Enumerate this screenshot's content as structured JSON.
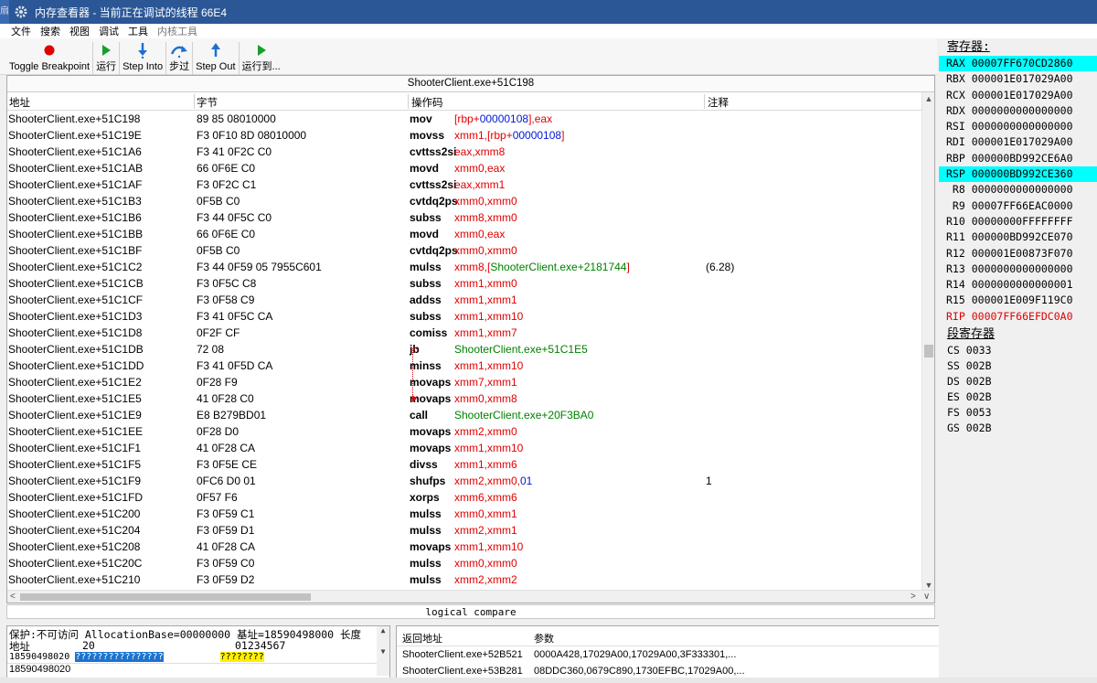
{
  "window": {
    "title": "内存查看器 - 当前正在调试的线程 66E4",
    "left_edge_text": "扇"
  },
  "menu": [
    "文件",
    "搜索",
    "视图",
    "调试",
    "工具",
    "内核工具"
  ],
  "toolbar": {
    "toggle_breakpoint": "Toggle Breakpoint",
    "run": "运行",
    "step_into": "Step Into",
    "step_over": "步过",
    "step_out": "Step Out",
    "run_to": "运行到..."
  },
  "disassembler": {
    "address_header": "ShooterClient.exe+51C198",
    "columns": {
      "address": "地址",
      "bytes": "字节",
      "opcode": "操作码",
      "comment": "注释"
    },
    "rows": [
      {
        "address": "ShooterClient.exe+51C198",
        "bytes": "89 85 08010000",
        "mnemonic": "mov",
        "operands": [
          {
            "t": "[rbp+",
            "c": "r"
          },
          {
            "t": "00000108",
            "c": "b"
          },
          {
            "t": "],eax",
            "c": "r"
          }
        ],
        "comment": ""
      },
      {
        "address": "ShooterClient.exe+51C19E",
        "bytes": "F3 0F10 8D 08010000",
        "mnemonic": "movss",
        "operands": [
          {
            "t": "xmm1,[rbp+",
            "c": "r"
          },
          {
            "t": "00000108",
            "c": "b"
          },
          {
            "t": "]",
            "c": "r"
          }
        ],
        "comment": ""
      },
      {
        "address": "ShooterClient.exe+51C1A6",
        "bytes": "F3 41 0F2C C0",
        "mnemonic": "cvttss2si",
        "operands": [
          {
            "t": "eax,xmm8",
            "c": "r"
          }
        ],
        "comment": ""
      },
      {
        "address": "ShooterClient.exe+51C1AB",
        "bytes": "66 0F6E C0",
        "mnemonic": "movd",
        "operands": [
          {
            "t": "xmm0,eax",
            "c": "r"
          }
        ],
        "comment": ""
      },
      {
        "address": "ShooterClient.exe+51C1AF",
        "bytes": "F3 0F2C C1",
        "mnemonic": "cvttss2si",
        "operands": [
          {
            "t": "eax,xmm1",
            "c": "r"
          }
        ],
        "comment": ""
      },
      {
        "address": "ShooterClient.exe+51C1B3",
        "bytes": "0F5B C0",
        "mnemonic": "cvtdq2ps",
        "operands": [
          {
            "t": "xmm0,xmm0",
            "c": "r"
          }
        ],
        "comment": ""
      },
      {
        "address": "ShooterClient.exe+51C1B6",
        "bytes": "F3 44 0F5C C0",
        "mnemonic": "subss",
        "operands": [
          {
            "t": "xmm8,xmm0",
            "c": "r"
          }
        ],
        "comment": ""
      },
      {
        "address": "ShooterClient.exe+51C1BB",
        "bytes": "66 0F6E C0",
        "mnemonic": "movd",
        "operands": [
          {
            "t": "xmm0,eax",
            "c": "r"
          }
        ],
        "comment": ""
      },
      {
        "address": "ShooterClient.exe+51C1BF",
        "bytes": "0F5B C0",
        "mnemonic": "cvtdq2ps",
        "operands": [
          {
            "t": "xmm0,xmm0",
            "c": "r"
          }
        ],
        "comment": ""
      },
      {
        "address": "ShooterClient.exe+51C1C2",
        "bytes": "F3 44 0F59 05 7955C601",
        "mnemonic": "mulss",
        "operands": [
          {
            "t": "xmm8,[",
            "c": "r"
          },
          {
            "t": "ShooterClient.exe+2181744",
            "c": "g"
          },
          {
            "t": "]",
            "c": "r"
          }
        ],
        "comment": "(6.28)"
      },
      {
        "address": "ShooterClient.exe+51C1CB",
        "bytes": "F3 0F5C C8",
        "mnemonic": "subss",
        "operands": [
          {
            "t": "xmm1,xmm0",
            "c": "r"
          }
        ],
        "comment": ""
      },
      {
        "address": "ShooterClient.exe+51C1CF",
        "bytes": "F3 0F58 C9",
        "mnemonic": "addss",
        "operands": [
          {
            "t": "xmm1,xmm1",
            "c": "r"
          }
        ],
        "comment": ""
      },
      {
        "address": "ShooterClient.exe+51C1D3",
        "bytes": "F3 41 0F5C CA",
        "mnemonic": "subss",
        "operands": [
          {
            "t": "xmm1,xmm10",
            "c": "r"
          }
        ],
        "comment": ""
      },
      {
        "address": "ShooterClient.exe+51C1D8",
        "bytes": "0F2F CF",
        "mnemonic": "comiss",
        "operands": [
          {
            "t": "xmm1,xmm7",
            "c": "r"
          }
        ],
        "comment": ""
      },
      {
        "address": "ShooterClient.exe+51C1DB",
        "bytes": "72 08",
        "mnemonic": "jb",
        "operands": [
          {
            "t": "ShooterClient.exe+51C1E5",
            "c": "g"
          }
        ],
        "comment": ""
      },
      {
        "address": "ShooterClient.exe+51C1DD",
        "bytes": "F3 41 0F5D CA",
        "mnemonic": "minss",
        "operands": [
          {
            "t": "xmm1,xmm10",
            "c": "r"
          }
        ],
        "comment": ""
      },
      {
        "address": "ShooterClient.exe+51C1E2",
        "bytes": "0F28 F9",
        "mnemonic": "movaps",
        "operands": [
          {
            "t": "xmm7,xmm1",
            "c": "r"
          }
        ],
        "comment": ""
      },
      {
        "address": "ShooterClient.exe+51C1E5",
        "bytes": "41 0F28 C0",
        "mnemonic": "movaps",
        "operands": [
          {
            "t": "xmm0,xmm8",
            "c": "r"
          }
        ],
        "comment": ""
      },
      {
        "address": "ShooterClient.exe+51C1E9",
        "bytes": "E8 B279BD01",
        "mnemonic": "call",
        "operands": [
          {
            "t": "ShooterClient.exe+20F3BA0",
            "c": "g"
          }
        ],
        "comment": ""
      },
      {
        "address": "ShooterClient.exe+51C1EE",
        "bytes": "0F28 D0",
        "mnemonic": "movaps",
        "operands": [
          {
            "t": "xmm2,xmm0",
            "c": "r"
          }
        ],
        "comment": ""
      },
      {
        "address": "ShooterClient.exe+51C1F1",
        "bytes": "41 0F28 CA",
        "mnemonic": "movaps",
        "operands": [
          {
            "t": "xmm1,xmm10",
            "c": "r"
          }
        ],
        "comment": ""
      },
      {
        "address": "ShooterClient.exe+51C1F5",
        "bytes": "F3 0F5E CE",
        "mnemonic": "divss",
        "operands": [
          {
            "t": "xmm1,xmm6",
            "c": "r"
          }
        ],
        "comment": ""
      },
      {
        "address": "ShooterClient.exe+51C1F9",
        "bytes": "0FC6 D0 01",
        "mnemonic": "shufps",
        "operands": [
          {
            "t": "xmm2,xmm0,",
            "c": "r"
          },
          {
            "t": "01",
            "c": "b"
          }
        ],
        "comment": "1"
      },
      {
        "address": "ShooterClient.exe+51C1FD",
        "bytes": "0F57 F6",
        "mnemonic": "xorps",
        "operands": [
          {
            "t": "xmm6,xmm6",
            "c": "r"
          }
        ],
        "comment": ""
      },
      {
        "address": "ShooterClient.exe+51C200",
        "bytes": "F3 0F59 C1",
        "mnemonic": "mulss",
        "operands": [
          {
            "t": "xmm0,xmm1",
            "c": "r"
          }
        ],
        "comment": ""
      },
      {
        "address": "ShooterClient.exe+51C204",
        "bytes": "F3 0F59 D1",
        "mnemonic": "mulss",
        "operands": [
          {
            "t": "xmm2,xmm1",
            "c": "r"
          }
        ],
        "comment": ""
      },
      {
        "address": "ShooterClient.exe+51C208",
        "bytes": "41 0F28 CA",
        "mnemonic": "movaps",
        "operands": [
          {
            "t": "xmm1,xmm10",
            "c": "r"
          }
        ],
        "comment": ""
      },
      {
        "address": "ShooterClient.exe+51C20C",
        "bytes": "F3 0F59 C0",
        "mnemonic": "mulss",
        "operands": [
          {
            "t": "xmm0,xmm0",
            "c": "r"
          }
        ],
        "comment": ""
      },
      {
        "address": "ShooterClient.exe+51C210",
        "bytes": "F3 0F59 D2",
        "mnemonic": "mulss",
        "operands": [
          {
            "t": "xmm2,xmm2",
            "c": "r"
          }
        ],
        "comment": ""
      }
    ],
    "status_text": "logical compare"
  },
  "hex_view": {
    "info_line": "保护:不可访问  AllocationBase=00000000 基址=18590498000 长度",
    "header_addr": "地址",
    "header_offset": "20",
    "header_cols": "01234567",
    "row_addr": "18590498020",
    "row_hex": "????????????????",
    "row_ascii": "????????",
    "address_box": "18590498020"
  },
  "stack_view": {
    "columns": {
      "return_address": "返回地址",
      "params": "参数"
    },
    "rows": [
      {
        "return_address": "ShooterClient.exe+52B521",
        "params": "0000A428,17029A00,17029A00,3F333301,..."
      },
      {
        "return_address": "ShooterClient.exe+53B281",
        "params": "08DDC360,0679C890,1730EFBC,17029A00,..."
      }
    ]
  },
  "registers": {
    "header": "寄存器:",
    "items": [
      {
        "name": "RAX",
        "value": "00007FF670CD2860",
        "state": "selected"
      },
      {
        "name": "RBX",
        "value": "000001E017029A00",
        "state": "normal"
      },
      {
        "name": "RCX",
        "value": "000001E017029A00",
        "state": "normal"
      },
      {
        "name": "RDX",
        "value": "0000000000000000",
        "state": "normal"
      },
      {
        "name": "RSI",
        "value": "0000000000000000",
        "state": "normal"
      },
      {
        "name": "RDI",
        "value": "000001E017029A00",
        "state": "normal"
      },
      {
        "name": "RBP",
        "value": "000000BD992CE6A0",
        "state": "normal"
      },
      {
        "name": "RSP",
        "value": "000000BD992CE360",
        "state": "selected"
      },
      {
        "name": " R8",
        "value": "0000000000000000",
        "state": "normal"
      },
      {
        "name": " R9",
        "value": "00007FF66EAC0000",
        "state": "normal"
      },
      {
        "name": "R10",
        "value": "00000000FFFFFFFF",
        "state": "normal"
      },
      {
        "name": "R11",
        "value": "000000BD992CE070",
        "state": "normal"
      },
      {
        "name": "R12",
        "value": "000001E00873F070",
        "state": "normal"
      },
      {
        "name": "R13",
        "value": "0000000000000000",
        "state": "normal"
      },
      {
        "name": "R14",
        "value": "0000000000000001",
        "state": "normal"
      },
      {
        "name": "R15",
        "value": "000001E009F119C0",
        "state": "normal"
      },
      {
        "name": "RIP",
        "value": "00007FF66EFDC0A0",
        "state": "changed"
      }
    ],
    "segment_header": "段寄存器",
    "segments": [
      {
        "name": "CS",
        "value": "0033"
      },
      {
        "name": "SS",
        "value": "002B"
      },
      {
        "name": "DS",
        "value": "002B"
      },
      {
        "name": "ES",
        "value": "002B"
      },
      {
        "name": "FS",
        "value": "0053"
      },
      {
        "name": "GS",
        "value": "002B"
      }
    ]
  },
  "colors": {
    "titlebar": "#2b5797",
    "register_highlight": "#00ffff",
    "operand_red": "#e00000",
    "operand_blue": "#0018d8",
    "symbol_green": "#008000"
  }
}
